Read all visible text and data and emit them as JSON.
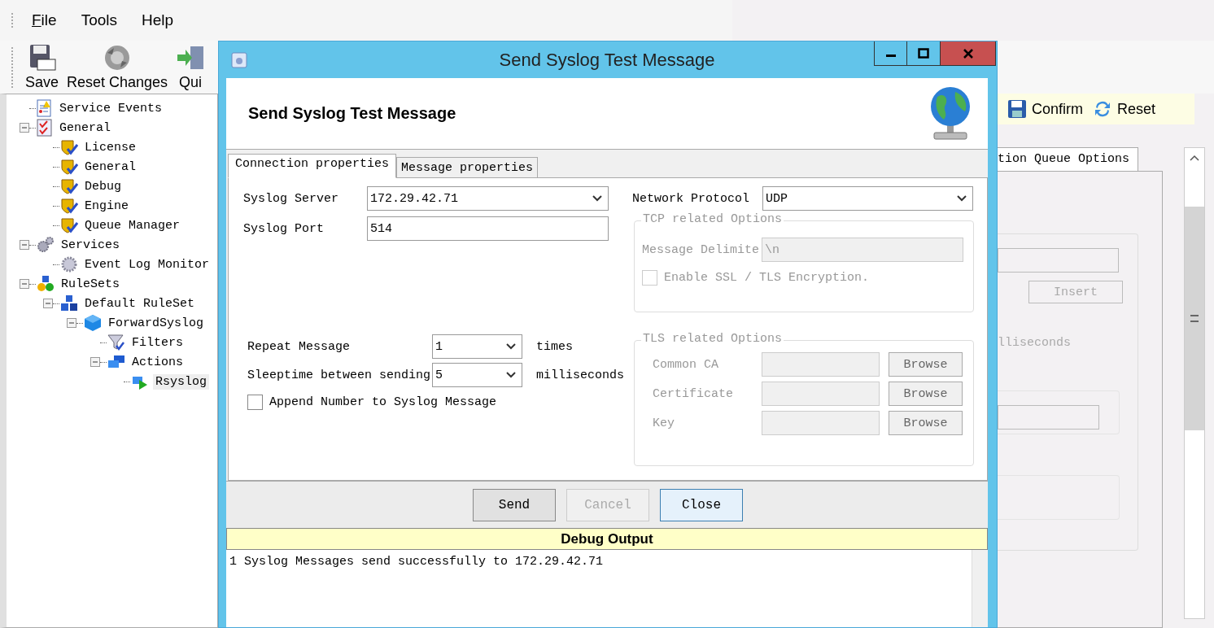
{
  "menu": [
    {
      "label": "File",
      "mnemonic": true
    },
    {
      "label": "Tools",
      "mnemonic": false
    },
    {
      "label": "Help",
      "mnemonic": false
    }
  ],
  "toolbar": [
    {
      "label": "Save",
      "kind": "save"
    },
    {
      "label": "Reset Changes",
      "kind": "reset"
    },
    {
      "label": "Qui",
      "kind": "quit"
    }
  ],
  "tree": [
    {
      "label": "Service Events",
      "kind": "events",
      "selected": false
    },
    {
      "label": "General",
      "kind": "checklist",
      "selected": false,
      "expanded": true,
      "children": [
        {
          "label": "License",
          "kind": "shield",
          "selected": false
        },
        {
          "label": "General",
          "kind": "shield",
          "selected": false
        },
        {
          "label": "Debug",
          "kind": "shield",
          "selected": false
        },
        {
          "label": "Engine",
          "kind": "shield",
          "selected": false
        },
        {
          "label": "Queue Manager",
          "kind": "shield",
          "selected": false
        }
      ]
    },
    {
      "label": "Services",
      "kind": "gears",
      "selected": false,
      "expanded": true,
      "children": [
        {
          "label": "Event Log Monitor",
          "kind": "gear",
          "selected": false
        }
      ]
    },
    {
      "label": "RuleSets",
      "kind": "rulesets",
      "selected": false,
      "expanded": true,
      "children": [
        {
          "label": "Default RuleSet",
          "kind": "ruleset",
          "selected": false,
          "expanded": true,
          "children": [
            {
              "label": "ForwardSyslog",
              "kind": "cube",
              "selected": false,
              "expanded": true,
              "children": [
                {
                  "label": "Filters",
                  "kind": "funnel",
                  "selected": false
                },
                {
                  "label": "Actions",
                  "kind": "actions",
                  "selected": false,
                  "expanded": true,
                  "children": [
                    {
                      "label": "Rsyslog",
                      "kind": "action",
                      "selected": true
                    }
                  ]
                }
              ]
            }
          ]
        }
      ]
    }
  ],
  "right_panel": {
    "toolbar": [
      {
        "label": "Confirm",
        "kind": "save"
      },
      {
        "label": "Reset",
        "kind": "reset"
      }
    ],
    "tab": "tion Queue Options",
    "insert_button": "Insert",
    "unit": "lliseconds"
  },
  "dialog": {
    "title": "Send Syslog Test Message",
    "heading": "Send Syslog Test Message",
    "tabs": [
      {
        "label": "Connection properties",
        "selected": true
      },
      {
        "label": "Message properties",
        "selected": false
      }
    ],
    "syslog_server": {
      "label": "Syslog Server",
      "value": "172.29.42.71"
    },
    "syslog_port": {
      "label": "Syslog Port",
      "value": "514"
    },
    "repeat": {
      "label": "Repeat Message",
      "value": "1",
      "unit": "times"
    },
    "sleeptime": {
      "label": "Sleeptime between sending",
      "value": "5",
      "unit": "milliseconds"
    },
    "append_number": {
      "label": "Append Number to Syslog Message",
      "checked": false
    },
    "protocol": {
      "label": "Network Protocol",
      "value": "UDP"
    },
    "tcp_options": {
      "title": "TCP related Options",
      "disabled": true,
      "delimiter": {
        "label": "Message Delimite",
        "value": "\\n"
      },
      "ssl": {
        "label": "Enable SSL / TLS Encryption.",
        "checked": false
      }
    },
    "tls_options": {
      "title": "TLS related Options",
      "disabled": true,
      "rows": [
        {
          "label": "Common CA",
          "button": "Browse"
        },
        {
          "label": "Certificate",
          "button": "Browse"
        },
        {
          "label": "Key",
          "button": "Browse"
        }
      ]
    },
    "buttons": [
      {
        "label": "Send",
        "disabled": false,
        "focused": false
      },
      {
        "label": "Cancel",
        "disabled": true,
        "focused": false
      },
      {
        "label": "Close",
        "disabled": false,
        "focused": true
      }
    ],
    "debug": {
      "title": "Debug Output",
      "lines": [
        "1 Syslog Messages send successfully to 172.29.42.71"
      ]
    }
  }
}
